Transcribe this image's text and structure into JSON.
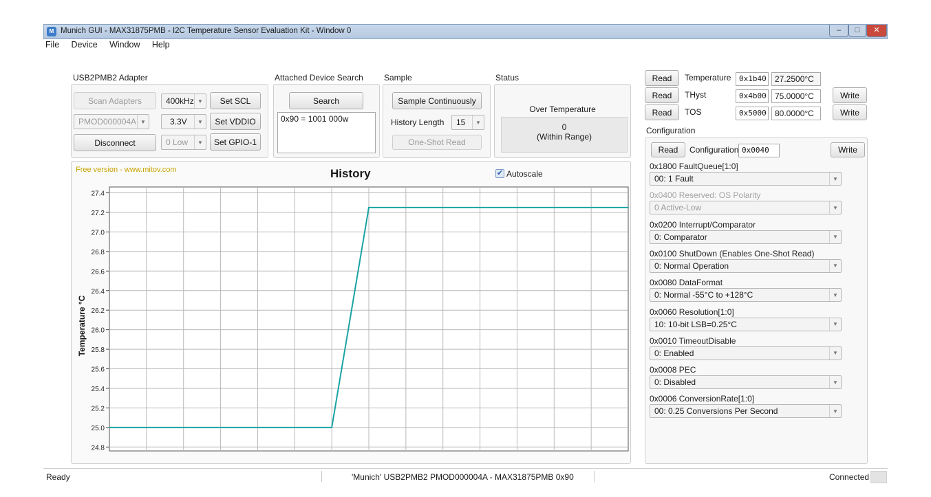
{
  "window": {
    "title": "Munich GUI - MAX31875PMB - I2C Temperature Sensor Evaluation Kit - Window 0",
    "app_icon": "M",
    "controls": {
      "minimize": "–",
      "maximize": "□",
      "close": "✕"
    }
  },
  "menu": {
    "file": "File",
    "device": "Device",
    "window": "Window",
    "help": "Help"
  },
  "adapter": {
    "title": "USB2PMB2 Adapter",
    "scan_label": "Scan Adapters",
    "adapter_value": "PMOD000004A",
    "disconnect_label": "Disconnect",
    "scl_value": "400kHz",
    "set_scl_label": "Set SCL",
    "vddio_value": "3.3V",
    "set_vddio_label": "Set VDDIO",
    "gpio_value": "0 Low",
    "set_gpio_label": "Set GPIO-1"
  },
  "device_search": {
    "title": "Attached Device Search",
    "search_label": "Search",
    "result": "0x90 = 1001 000w"
  },
  "sample": {
    "title": "Sample",
    "continuous_label": "Sample Continuously",
    "history_length_label": "History Length",
    "history_length_value": "15",
    "one_shot_label": "One-Shot Read"
  },
  "status": {
    "title": "Status",
    "heading": "Over Temperature",
    "value": "0",
    "range": "(Within Range)"
  },
  "history": {
    "watermark": "Free version - www.mitov.com",
    "title": "History",
    "autoscale_label": "Autoscale",
    "autoscale_checked": true
  },
  "chart_data": {
    "type": "line",
    "title": "History",
    "ylabel": "Temperature °C",
    "xlabel": "",
    "ylim": [
      24.76,
      27.46
    ],
    "y_ticks": [
      "27.4",
      "27.2",
      "27.0",
      "26.8",
      "26.6",
      "26.4",
      "26.2",
      "26.0",
      "25.8",
      "25.6",
      "25.4",
      "25.2",
      "25.0",
      "24.8"
    ],
    "x_divisions": 14,
    "grid": true,
    "line_color": "#1aa3a3",
    "series": [
      {
        "x": [
          0,
          6,
          7,
          14
        ],
        "values": [
          25.0,
          25.0,
          27.25,
          27.25
        ]
      }
    ]
  },
  "registers": {
    "read_label": "Read",
    "write_label": "Write",
    "temperature": {
      "name": "Temperature",
      "hex": "0x1b40",
      "value": "27.2500°C"
    },
    "thyst": {
      "name": "THyst",
      "hex": "0x4b00",
      "value": "75.0000°C"
    },
    "tos": {
      "name": "TOS",
      "hex": "0x5000",
      "value": "80.0000°C"
    }
  },
  "configuration": {
    "title": "Configuration",
    "read_label": "Read",
    "name": "Configuration",
    "hex": "0x0040",
    "write_label": "Write",
    "fields": [
      {
        "label": "0x1800 FaultQueue[1:0]",
        "value": "00: 1 Fault",
        "disabled": false
      },
      {
        "label": "0x0400 Reserved: OS Polarity",
        "value": "0 Active-Low",
        "disabled": true
      },
      {
        "label": "0x0200 Interrupt/Comparator",
        "value": "0: Comparator",
        "disabled": false
      },
      {
        "label": "0x0100 ShutDown (Enables One-Shot Read)",
        "value": "0: Normal Operation",
        "disabled": false
      },
      {
        "label": "0x0080 DataFormat",
        "value": "0: Normal -55°C to +128°C",
        "disabled": false
      },
      {
        "label": "0x0060 Resolution[1:0]",
        "value": "10: 10-bit LSB=0.25°C",
        "disabled": false
      },
      {
        "label": "0x0010 TimeoutDisable",
        "value": "0: Enabled",
        "disabled": false
      },
      {
        "label": "0x0008 PEC",
        "value": "0: Disabled",
        "disabled": false
      },
      {
        "label": "0x0006 ConversionRate[1:0]",
        "value": "00: 0.25 Conversions Per Second",
        "disabled": false
      }
    ]
  },
  "statusbar": {
    "state": "Ready",
    "connection_info": "'Munich' USB2PMB2 PMOD000004A - MAX31875PMB 0x90",
    "connected": "Connected"
  }
}
